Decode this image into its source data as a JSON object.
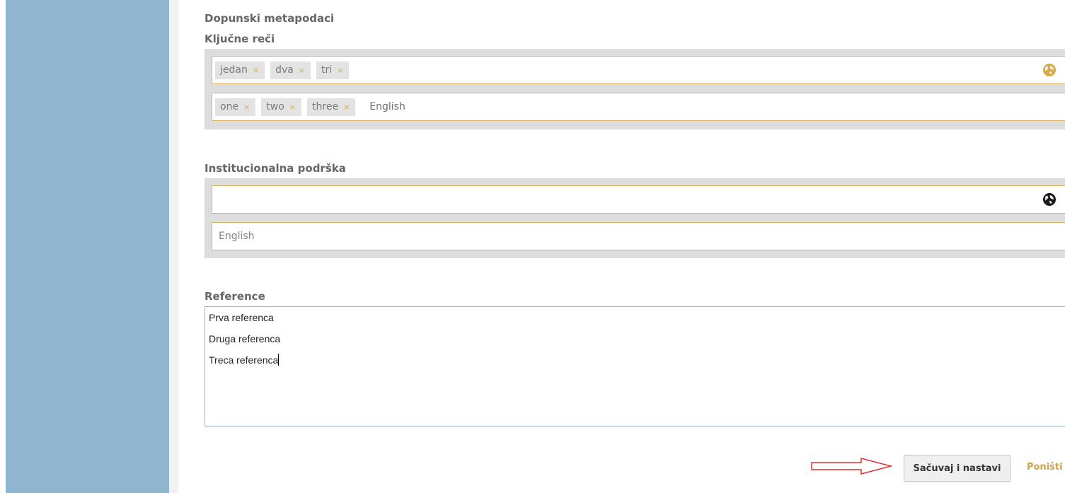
{
  "sections": {
    "metadata_heading": "Dopunski metapodaci",
    "keywords": {
      "heading": "Ključne reči",
      "local_tags": [
        "jedan",
        "dva",
        "tri"
      ],
      "english_tags": [
        "one",
        "two",
        "three"
      ],
      "english_label": "English",
      "remove_glyph": "×"
    },
    "institutional_support": {
      "heading": "Institucionalna podrška",
      "value": "",
      "english_placeholder": "English"
    },
    "references": {
      "heading": "Reference",
      "lines": [
        "Prva referenca",
        "Druga referenca",
        "Treca referenca"
      ]
    }
  },
  "actions": {
    "save_label": "Sačuvaj i nastavi",
    "cancel_label": "Poništi"
  },
  "icons": {
    "globe_keywords": "globe-icon",
    "globe_institution": "globe-icon",
    "arrow": "arrow-right-icon"
  },
  "colors": {
    "sidebar": "#8fb5cf",
    "panel": "#dddddd",
    "field_border": "#d9b45f",
    "tag_x": "#dcaa4a",
    "globe_keywords": "#d8a94c",
    "globe_institution": "#1a1a1a",
    "textarea_border": "#9db3d4",
    "arrow": "#e03030",
    "cancel": "#cfa24e"
  }
}
